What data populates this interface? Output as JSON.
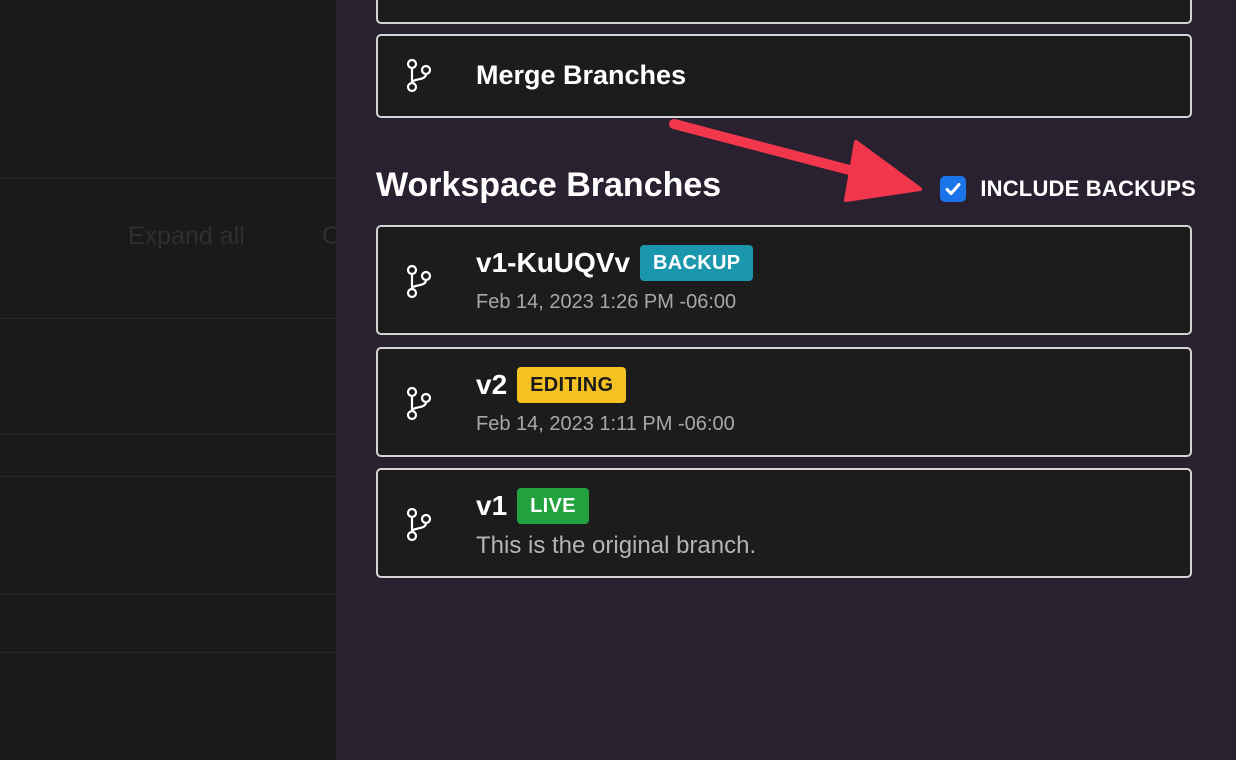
{
  "background": {
    "expand_all_label": "Expand all",
    "collapse_stub_label": "C"
  },
  "merge": {
    "label": "Merge Branches",
    "icon": "git-branch-icon"
  },
  "section": {
    "title": "Workspace Branches"
  },
  "include_backups": {
    "label": "INCLUDE BACKUPS",
    "checked": true
  },
  "branches": [
    {
      "name": "v1-KuUQVv",
      "badge": "BACKUP",
      "badge_color": "#1a97ad",
      "sub": "Feb 14, 2023 1:26 PM -06:00"
    },
    {
      "name": "v2",
      "badge": "EDITING",
      "badge_color": "#f6c223",
      "sub": "Feb 14, 2023 1:11 PM -06:00"
    },
    {
      "name": "v1",
      "badge": "LIVE",
      "badge_color": "#22a23f",
      "sub": "This is the original branch."
    }
  ],
  "colors": {
    "panel_bg": "#2a2130",
    "card_bg": "#1c1c1c",
    "card_border": "#d4d4d4",
    "checkbox": "#1a73e8",
    "annotation_arrow": "#f2364b"
  }
}
